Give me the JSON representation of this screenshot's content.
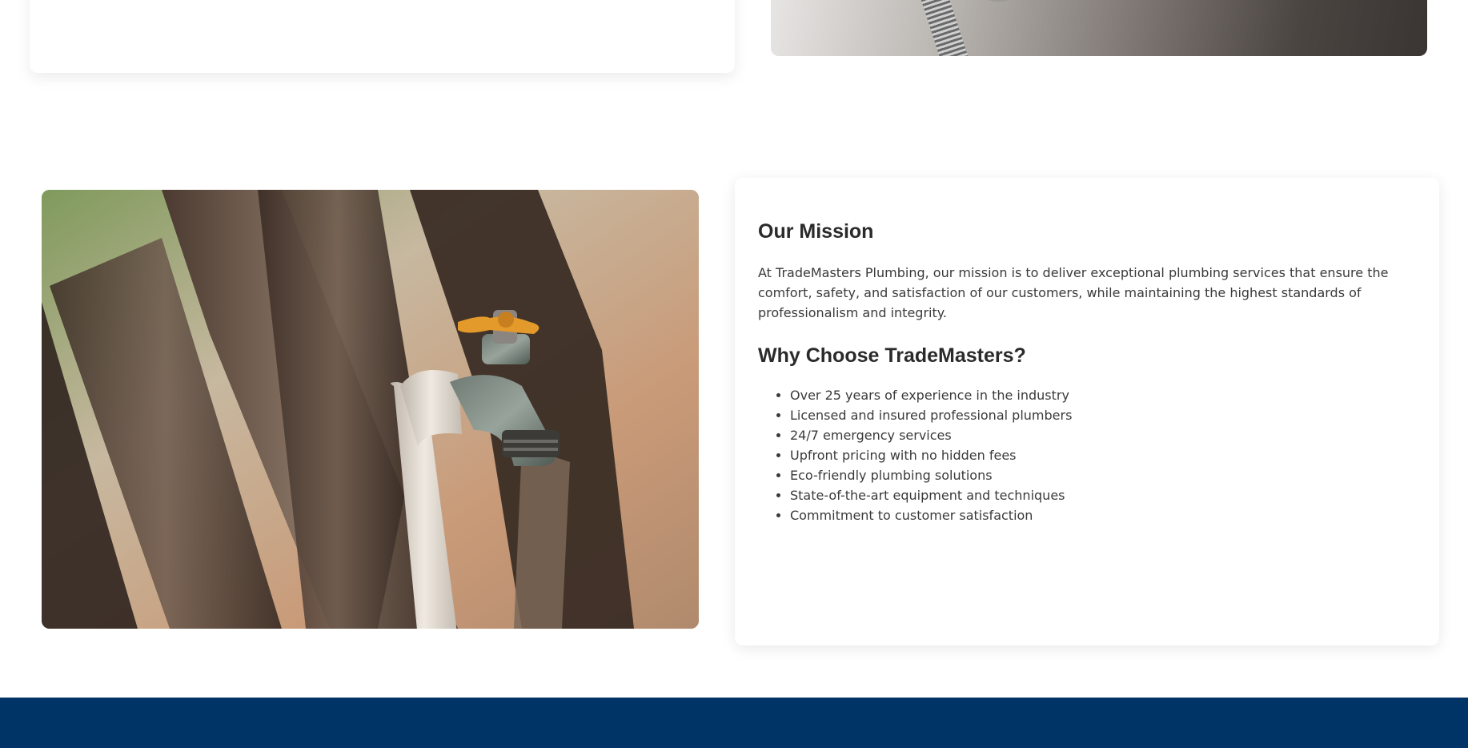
{
  "mission": {
    "heading": "Our Mission",
    "body": "At TradeMasters Plumbing, our mission is to deliver exceptional plumbing services that ensure the comfort, safety, and satisfaction of our customers, while maintaining the highest standards of professionalism and integrity."
  },
  "why_choose": {
    "heading": "Why Choose TradeMasters?",
    "items": [
      "Over 25 years of experience in the industry",
      "Licensed and insured professional plumbers",
      "24/7 emergency services",
      "Upfront pricing with no hidden fees",
      "Eco-friendly plumbing solutions",
      "State-of-the-art equipment and techniques",
      "Commitment to customer satisfaction"
    ]
  },
  "colors": {
    "footer": "#003366",
    "heading": "#2a2a2a",
    "body_text": "#3a3a3a"
  },
  "images": {
    "top_photo": "bathroom-shower-fixture-photo",
    "main_photo": "outdoor-faucet-on-tree-photo"
  }
}
